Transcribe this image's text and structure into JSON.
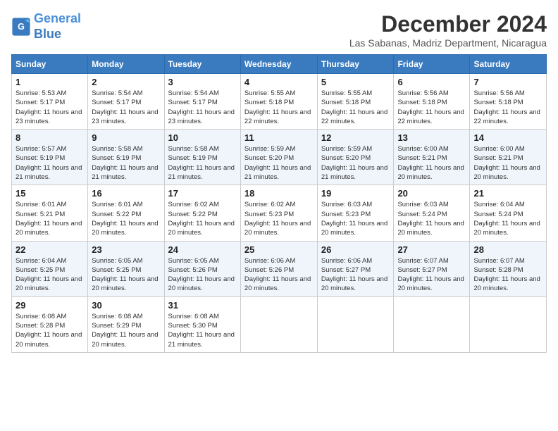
{
  "logo": {
    "line1": "General",
    "line2": "Blue"
  },
  "title": "December 2024",
  "location": "Las Sabanas, Madriz Department, Nicaragua",
  "weekdays": [
    "Sunday",
    "Monday",
    "Tuesday",
    "Wednesday",
    "Thursday",
    "Friday",
    "Saturday"
  ],
  "weeks": [
    [
      {
        "day": "1",
        "rise": "5:53 AM",
        "set": "5:17 PM",
        "daylight": "11 hours and 23 minutes."
      },
      {
        "day": "2",
        "rise": "5:54 AM",
        "set": "5:17 PM",
        "daylight": "11 hours and 23 minutes."
      },
      {
        "day": "3",
        "rise": "5:54 AM",
        "set": "5:17 PM",
        "daylight": "11 hours and 23 minutes."
      },
      {
        "day": "4",
        "rise": "5:55 AM",
        "set": "5:18 PM",
        "daylight": "11 hours and 22 minutes."
      },
      {
        "day": "5",
        "rise": "5:55 AM",
        "set": "5:18 PM",
        "daylight": "11 hours and 22 minutes."
      },
      {
        "day": "6",
        "rise": "5:56 AM",
        "set": "5:18 PM",
        "daylight": "11 hours and 22 minutes."
      },
      {
        "day": "7",
        "rise": "5:56 AM",
        "set": "5:18 PM",
        "daylight": "11 hours and 22 minutes."
      }
    ],
    [
      {
        "day": "8",
        "rise": "5:57 AM",
        "set": "5:19 PM",
        "daylight": "11 hours and 21 minutes."
      },
      {
        "day": "9",
        "rise": "5:58 AM",
        "set": "5:19 PM",
        "daylight": "11 hours and 21 minutes."
      },
      {
        "day": "10",
        "rise": "5:58 AM",
        "set": "5:19 PM",
        "daylight": "11 hours and 21 minutes."
      },
      {
        "day": "11",
        "rise": "5:59 AM",
        "set": "5:20 PM",
        "daylight": "11 hours and 21 minutes."
      },
      {
        "day": "12",
        "rise": "5:59 AM",
        "set": "5:20 PM",
        "daylight": "11 hours and 21 minutes."
      },
      {
        "day": "13",
        "rise": "6:00 AM",
        "set": "5:21 PM",
        "daylight": "11 hours and 20 minutes."
      },
      {
        "day": "14",
        "rise": "6:00 AM",
        "set": "5:21 PM",
        "daylight": "11 hours and 20 minutes."
      }
    ],
    [
      {
        "day": "15",
        "rise": "6:01 AM",
        "set": "5:21 PM",
        "daylight": "11 hours and 20 minutes."
      },
      {
        "day": "16",
        "rise": "6:01 AM",
        "set": "5:22 PM",
        "daylight": "11 hours and 20 minutes."
      },
      {
        "day": "17",
        "rise": "6:02 AM",
        "set": "5:22 PM",
        "daylight": "11 hours and 20 minutes."
      },
      {
        "day": "18",
        "rise": "6:02 AM",
        "set": "5:23 PM",
        "daylight": "11 hours and 20 minutes."
      },
      {
        "day": "19",
        "rise": "6:03 AM",
        "set": "5:23 PM",
        "daylight": "11 hours and 20 minutes."
      },
      {
        "day": "20",
        "rise": "6:03 AM",
        "set": "5:24 PM",
        "daylight": "11 hours and 20 minutes."
      },
      {
        "day": "21",
        "rise": "6:04 AM",
        "set": "5:24 PM",
        "daylight": "11 hours and 20 minutes."
      }
    ],
    [
      {
        "day": "22",
        "rise": "6:04 AM",
        "set": "5:25 PM",
        "daylight": "11 hours and 20 minutes."
      },
      {
        "day": "23",
        "rise": "6:05 AM",
        "set": "5:25 PM",
        "daylight": "11 hours and 20 minutes."
      },
      {
        "day": "24",
        "rise": "6:05 AM",
        "set": "5:26 PM",
        "daylight": "11 hours and 20 minutes."
      },
      {
        "day": "25",
        "rise": "6:06 AM",
        "set": "5:26 PM",
        "daylight": "11 hours and 20 minutes."
      },
      {
        "day": "26",
        "rise": "6:06 AM",
        "set": "5:27 PM",
        "daylight": "11 hours and 20 minutes."
      },
      {
        "day": "27",
        "rise": "6:07 AM",
        "set": "5:27 PM",
        "daylight": "11 hours and 20 minutes."
      },
      {
        "day": "28",
        "rise": "6:07 AM",
        "set": "5:28 PM",
        "daylight": "11 hours and 20 minutes."
      }
    ],
    [
      {
        "day": "29",
        "rise": "6:08 AM",
        "set": "5:28 PM",
        "daylight": "11 hours and 20 minutes."
      },
      {
        "day": "30",
        "rise": "6:08 AM",
        "set": "5:29 PM",
        "daylight": "11 hours and 20 minutes."
      },
      {
        "day": "31",
        "rise": "6:08 AM",
        "set": "5:30 PM",
        "daylight": "11 hours and 21 minutes."
      },
      null,
      null,
      null,
      null
    ]
  ]
}
